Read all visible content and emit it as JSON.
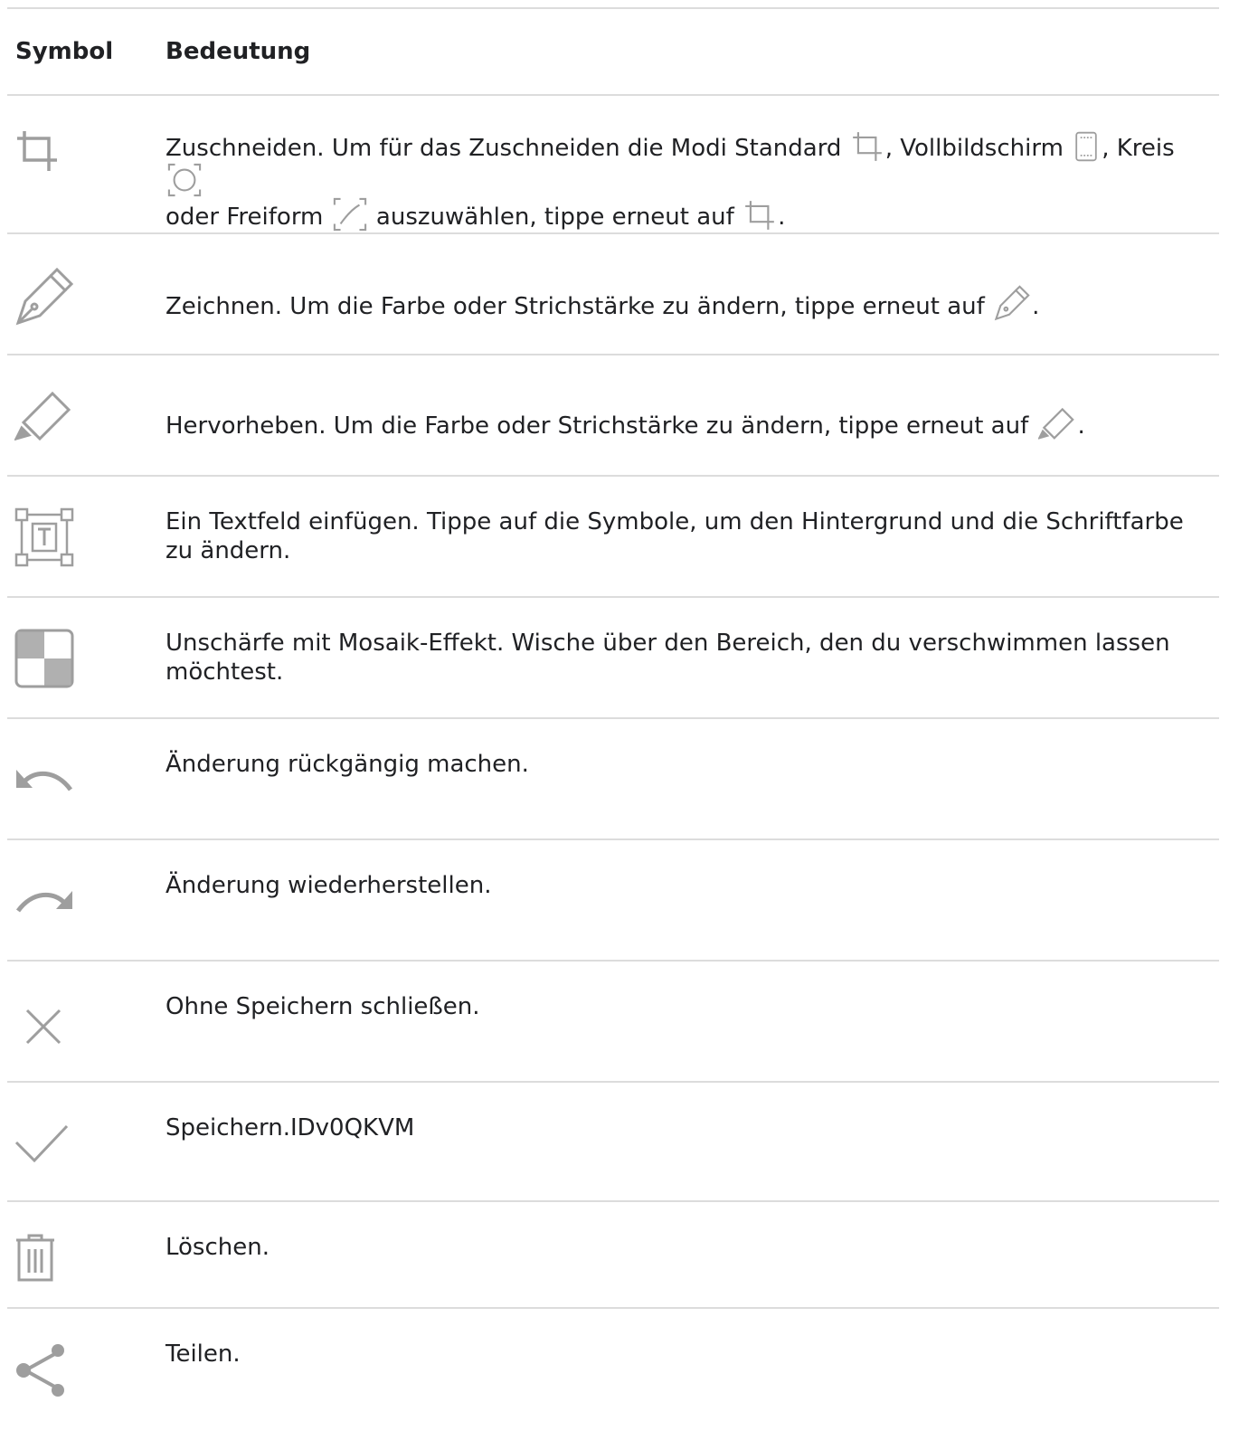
{
  "header": {
    "symbol": "Symbol",
    "meaning": "Bedeutung"
  },
  "rows": [
    {
      "icon": "crop-icon",
      "text": [
        "Zuschneiden. Um für das Zuschneiden die Modi Standard ",
        ", Vollbildschirm ",
        ", Kreis ",
        "oder Freiform ",
        " auszuwählen, tippe erneut auf ",
        "."
      ]
    },
    {
      "icon": "draw-pen-icon",
      "text": [
        "Zeichnen. Um die Farbe oder Strichstärke zu ändern, tippe erneut auf ",
        "."
      ]
    },
    {
      "icon": "highlighter-icon",
      "text": [
        "Hervorheben. Um die Farbe oder Strichstärke zu ändern, tippe erneut auf ",
        "."
      ]
    },
    {
      "icon": "text-box-icon",
      "text": [
        "Ein Textfeld einfügen. Tippe auf die Symbole, um den Hintergrund und die Schriftfarbe zu ändern."
      ]
    },
    {
      "icon": "mosaic-blur-icon",
      "text": [
        "Unschärfe mit Mosaik-Effekt. Wische über den Bereich, den du verschwimmen lassen möchtest."
      ]
    },
    {
      "icon": "undo-icon",
      "text": [
        "Änderung rückgängig machen."
      ]
    },
    {
      "icon": "redo-icon",
      "text": [
        "Änderung wiederherstellen."
      ]
    },
    {
      "icon": "close-icon",
      "text": [
        "Ohne Speichern schließen."
      ]
    },
    {
      "icon": "checkmark-icon",
      "text": [
        "Speichern.IDv0QKVM"
      ]
    },
    {
      "icon": "trash-icon",
      "text": [
        "Löschen."
      ]
    },
    {
      "icon": "share-icon",
      "text": [
        "Teilen."
      ]
    }
  ]
}
